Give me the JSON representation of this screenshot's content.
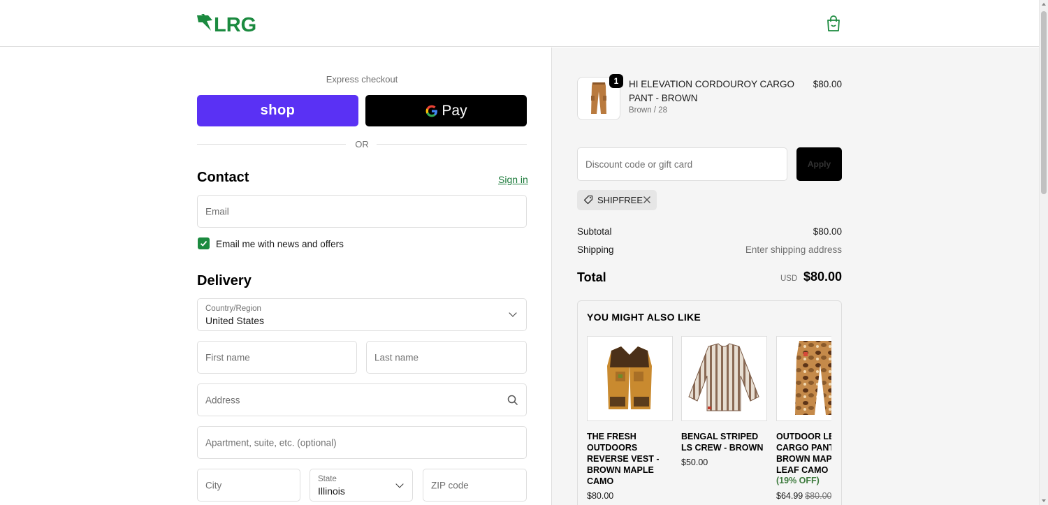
{
  "header": {
    "logo_text": "LRG",
    "cart_icon": "shopping-bag-icon"
  },
  "express": {
    "label": "Express checkout",
    "shop_label": "shop",
    "gpay_label": "Pay",
    "or_label": "OR"
  },
  "contact": {
    "title": "Contact",
    "signin": "Sign in",
    "email_placeholder": "Email",
    "newsletter_label": "Email me with news and offers",
    "newsletter_checked": true
  },
  "delivery": {
    "title": "Delivery",
    "country_label": "Country/Region",
    "country_value": "United States",
    "first_name_placeholder": "First name",
    "last_name_placeholder": "Last name",
    "address_placeholder": "Address",
    "apartment_placeholder": "Apartment, suite, etc. (optional)",
    "city_placeholder": "City",
    "state_label": "State",
    "state_value": "Illinois",
    "zip_placeholder": "ZIP code"
  },
  "order": {
    "item": {
      "quantity": "1",
      "name": "HI ELEVATION CORDOUROY CARGO PANT - BROWN",
      "variant": "Brown / 28",
      "price": "$80.00"
    },
    "discount_placeholder": "Discount code or gift card",
    "apply_label": "Apply",
    "applied_code": "SHIPFREE",
    "subtotal_label": "Subtotal",
    "subtotal_value": "$80.00",
    "shipping_label": "Shipping",
    "shipping_value": "Enter shipping address",
    "total_label": "Total",
    "total_currency": "USD",
    "total_value": "$80.00"
  },
  "upsell": {
    "title": "YOU MIGHT ALSO LIKE",
    "products": [
      {
        "name": "THE FRESH OUTDOORS REVERSE VEST - BROWN MAPLE CAMO",
        "price": "$80.00"
      },
      {
        "name": "BENGAL STRIPED LS CREW - BROWN",
        "price": "$50.00"
      },
      {
        "name": "OUTDOOR LEAF CARGO PANT - BROWN MAPLE LEAF CAMO",
        "discount": "(19% OFF)",
        "price": "$64.99",
        "compare_price": "$80.00"
      }
    ]
  },
  "colors": {
    "brand_green": "#1b8a3f",
    "shop_purple": "#5a31f4",
    "panel_bg": "#f5f5f5"
  }
}
